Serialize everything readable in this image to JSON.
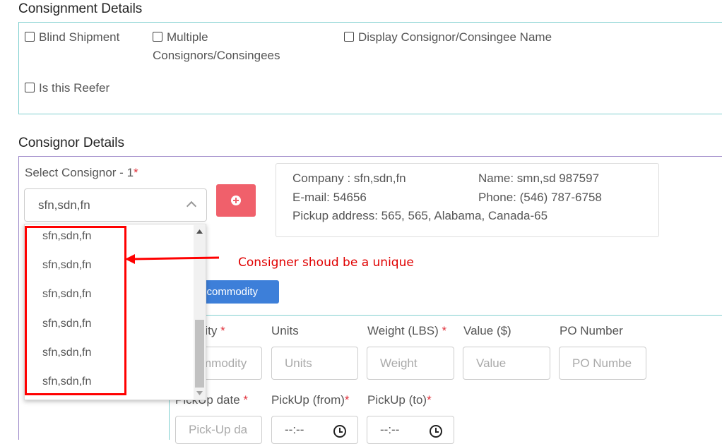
{
  "consignment": {
    "title": "Consignment Details",
    "options": [
      {
        "label": "Blind Shipment"
      },
      {
        "label": "Multiple Consignors/Consingees",
        "line1": "Multiple",
        "line2": "Consignors/Consingees"
      },
      {
        "label": "Display Consignor/Consingee Name"
      },
      {
        "label": "Is this Reefer"
      }
    ]
  },
  "consignor": {
    "title": "Consignor Details",
    "select_label": "Select Consignor - 1",
    "required_mark": "*",
    "selected_value": "sfn,sdn,fn",
    "dropdown_options": [
      "sfn,sdn,fn",
      "sfn,sdn,fn",
      "sfn,sdn,fn",
      "sfn,sdn,fn",
      "sfn,sdn,fn",
      "sfn,sdn,fn"
    ],
    "info": {
      "company": "Company : sfn,sdn,fn",
      "name": "Name: smn,sd 987597",
      "email": "E-mail: 54656",
      "phone": "Phone: (546) 787-6758",
      "pickup_address": "Pickup address: 565, 565, Alabama, Canada-65"
    }
  },
  "commodity": {
    "add_button_label": "d commodity",
    "labels": {
      "commodity": "nodity",
      "units": "Units",
      "weight": "Weight (LBS)",
      "value": "Value ($)",
      "po_number": "PO Number",
      "pickup_date": "PickUp date",
      "pickup_from": "PickUp (from)",
      "pickup_to": "PickUp (to)"
    },
    "placeholders": {
      "commodity": "mmodity",
      "units": "Units",
      "weight": "Weight",
      "value": "Value",
      "po_number": "PO Numbe",
      "pickup_date": "Pick-Up da",
      "time": "--:--"
    }
  },
  "annotation": {
    "text": "Consigner shoud be a unique",
    "color": "#ff0000"
  },
  "colors": {
    "accent_teal": "#7fcfcf",
    "accent_purple": "#9b86c8",
    "danger": "#f0606b",
    "primary": "#3d7fd9",
    "required": "#e0323c"
  }
}
